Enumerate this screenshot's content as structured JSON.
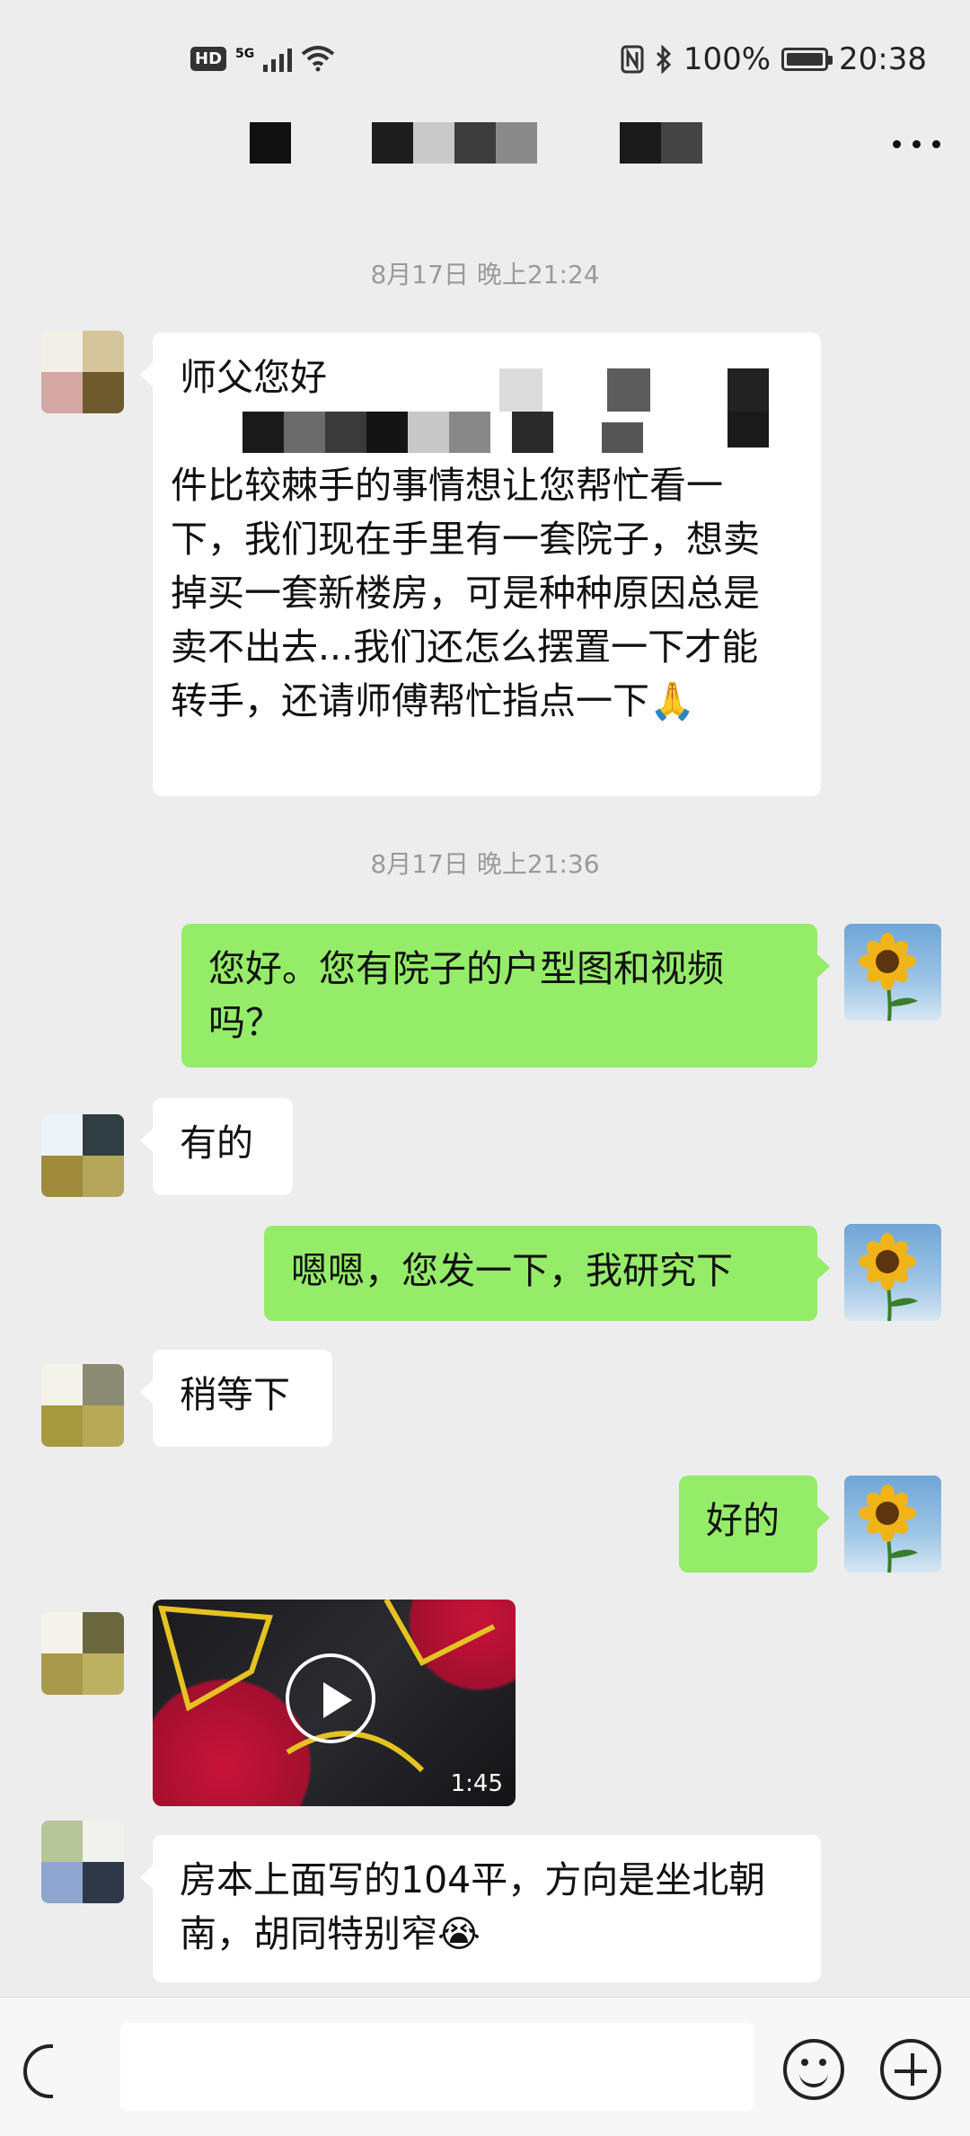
{
  "status_bar": {
    "hd_label": "HD",
    "network_label": "5G",
    "battery_text": "100%",
    "time": "20:38"
  },
  "chat": {
    "contact_name_obscured": true,
    "more_icon": "more-dots-icon"
  },
  "messages": [
    {
      "type": "timestamp",
      "text": "8月17日 晚上21:24"
    },
    {
      "type": "text",
      "side": "in",
      "line1": "师父您好",
      "body": "件比较棘手的事情想让您帮忙看一下，我们现在手里有一套院子，想卖掉买一套新楼房，可是种种原因总是卖不出去...我们还怎么摆置一下才能转手，还请师傅帮忙指点一下🙏"
    },
    {
      "type": "timestamp",
      "text": "8月17日 晚上21:36"
    },
    {
      "type": "text",
      "side": "out",
      "text": "您好。您有院子的户型图和视频吗？"
    },
    {
      "type": "text",
      "side": "in",
      "text": "有的"
    },
    {
      "type": "text",
      "side": "out",
      "text": "嗯嗯，您发一下，我研究下"
    },
    {
      "type": "text",
      "side": "in",
      "text": "稍等下"
    },
    {
      "type": "text",
      "side": "out",
      "text": "好的"
    },
    {
      "type": "video",
      "side": "in",
      "duration": "1:45"
    },
    {
      "type": "text",
      "side": "in",
      "text": "房本上面写的104平，方向是坐北朝南，胡同特别窄😭"
    }
  ],
  "input_bar": {
    "voice_icon": "voice-icon",
    "input_value": "",
    "emoji_icon": "emoji-icon",
    "plus_icon": "plus-icon"
  },
  "colors": {
    "background": "#ededed",
    "bubble_out": "#95ec69",
    "bubble_in": "#ffffff",
    "timestamp": "#9a9a9a"
  }
}
